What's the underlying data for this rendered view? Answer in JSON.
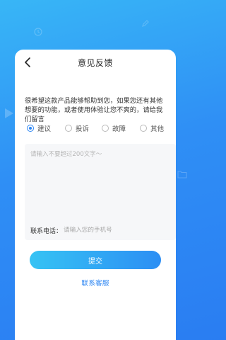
{
  "header": {
    "title": "意见反馈"
  },
  "intro": "很希望这款产品能够帮助到您，如果您还有其他想要的功能，或者使用体验让您不爽的，请给我们留言",
  "feedback_types": [
    {
      "label": "建议",
      "selected": true
    },
    {
      "label": "投诉",
      "selected": false
    },
    {
      "label": "故障",
      "selected": false
    },
    {
      "label": "其他",
      "selected": false
    }
  ],
  "content": {
    "placeholder": "请输入不要超过200文字～",
    "value": ""
  },
  "phone": {
    "label": "联系电话：",
    "placeholder": "请输入您的手机号",
    "value": ""
  },
  "submit_label": "提交",
  "contact_label": "联系客服",
  "colors": {
    "accent": "#2d86f3",
    "background": "#3394f5"
  }
}
